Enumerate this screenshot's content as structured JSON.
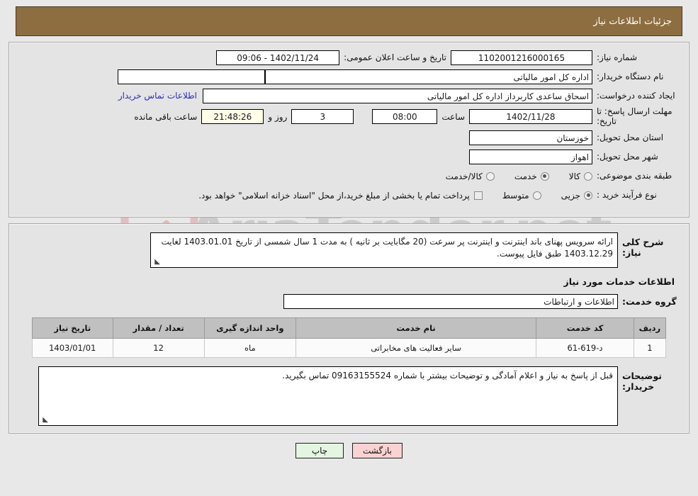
{
  "header": {
    "title": "جزئیات اطلاعات نیاز",
    "bg_color": "#8d6e41"
  },
  "watermark": {
    "text": "AriaTender.net",
    "logo_color": "#d8a9a9"
  },
  "details": {
    "need_number_label": "شماره نیاز:",
    "need_number_value": "1102001216000165",
    "public_announce_label": "تاریخ و ساعت اعلان عمومی:",
    "public_announce_value": "1402/11/24 - 09:06",
    "buyer_org_label": "نام دستگاه خریدار:",
    "buyer_org_value": "اداره کل امور مالیاتی",
    "creator_label": "ایجاد کننده درخواست:",
    "creator_value": "اسحاق ساعدی کاربرداز اداره کل امور مالیاتی",
    "contact_link": "اطلاعات تماس خریدار",
    "deadline_label": "مهلت ارسال پاسخ: تا تاریخ:",
    "deadline_date": "1402/11/28",
    "hour_label": "ساعت",
    "deadline_time": "08:00",
    "days_value": "3",
    "days_label": "روز و",
    "remaining_time": "21:48:26",
    "remaining_label": "ساعت باقی مانده",
    "province_label": "استان محل تحویل:",
    "province_value": "خوزستان",
    "city_label": "شهر محل تحویل:",
    "city_value": "اهواز",
    "category_label": "طبقه بندی موضوعی:",
    "category_options": [
      {
        "label": "کالا",
        "selected": false
      },
      {
        "label": "خدمت",
        "selected": true
      },
      {
        "label": "کالا/خدمت",
        "selected": false
      }
    ],
    "process_label": "نوع فرآیند خرید :",
    "process_options": [
      {
        "label": "جزیی",
        "selected": true
      },
      {
        "label": "متوسط",
        "selected": false
      }
    ],
    "treasury_note": "پرداخت تمام یا بخشی از مبلغ خرید،از محل \"اسناد خزانه اسلامی\" خواهد بود."
  },
  "description": {
    "label": "شرح کلی نیاز:",
    "value": "ارائه سرویس پهنای باند اینترنت و اینترنت پر سرعت (20 مگابایت بر ثانیه ) به مدت 1 سال شمسی از تاریخ 1403.01.01 لغایت 1403.12.29 طبق فایل پیوست."
  },
  "services": {
    "section_title": "اطلاعات خدمات مورد نیاز",
    "group_label": "گروه خدمت:",
    "group_value": "اطلاعات و ارتباطات",
    "table": {
      "columns": [
        "ردیف",
        "کد خدمت",
        "نام خدمت",
        "واحد اندازه گیری",
        "تعداد / مقدار",
        "تاریخ نیاز"
      ],
      "rows": [
        {
          "radif": "1",
          "code": "د-619-61",
          "name": "سایر فعالیت های مخابراتی",
          "unit": "ماه",
          "qty": "12",
          "date": "1403/01/01"
        }
      ]
    }
  },
  "notes": {
    "label": "توضیحات خریدار:",
    "value": "قبل از پاسخ به نیاز و اعلام آمادگی و توضیحات بیشتر با شماره 09163155524 تماس بگیرید."
  },
  "footer": {
    "print_label": "چاپ",
    "back_label": "بازگشت"
  }
}
